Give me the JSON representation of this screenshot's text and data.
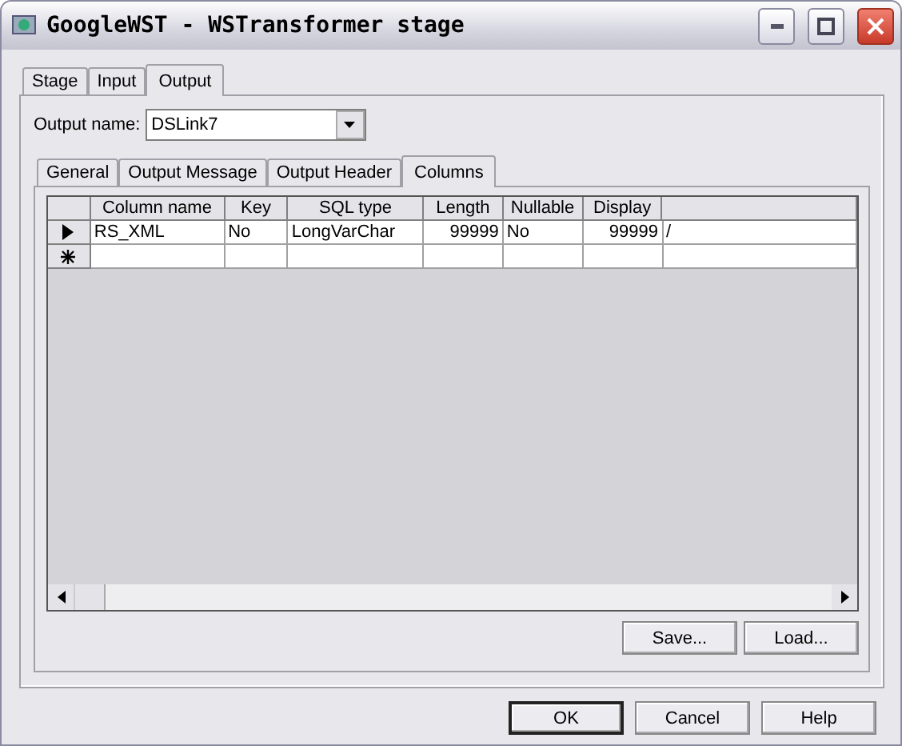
{
  "window": {
    "title": "GoogleWST - WSTransformer stage"
  },
  "tabs": [
    {
      "label": "Stage",
      "selected": false
    },
    {
      "label": "Input",
      "selected": false
    },
    {
      "label": "Output",
      "selected": true
    }
  ],
  "output_name": {
    "label": "Output name:",
    "value": "DSLink7"
  },
  "subtabs": [
    {
      "label": "General",
      "selected": false
    },
    {
      "label": "Output Message",
      "selected": false
    },
    {
      "label": "Output Header",
      "selected": false
    },
    {
      "label": "Columns",
      "selected": true
    }
  ],
  "table": {
    "columns": [
      "Column name",
      "Key",
      "SQL type",
      "Length",
      "Nullable",
      "Display"
    ],
    "rows": [
      {
        "kind": "current",
        "cells": [
          "RS_XML",
          "No",
          "LongVarChar",
          "99999",
          "No",
          "99999",
          "/"
        ]
      },
      {
        "kind": "new"
      }
    ]
  },
  "grid_buttons": [
    "Save...",
    "Load..."
  ],
  "buttons": [
    "OK",
    "Cancel",
    "Help"
  ]
}
